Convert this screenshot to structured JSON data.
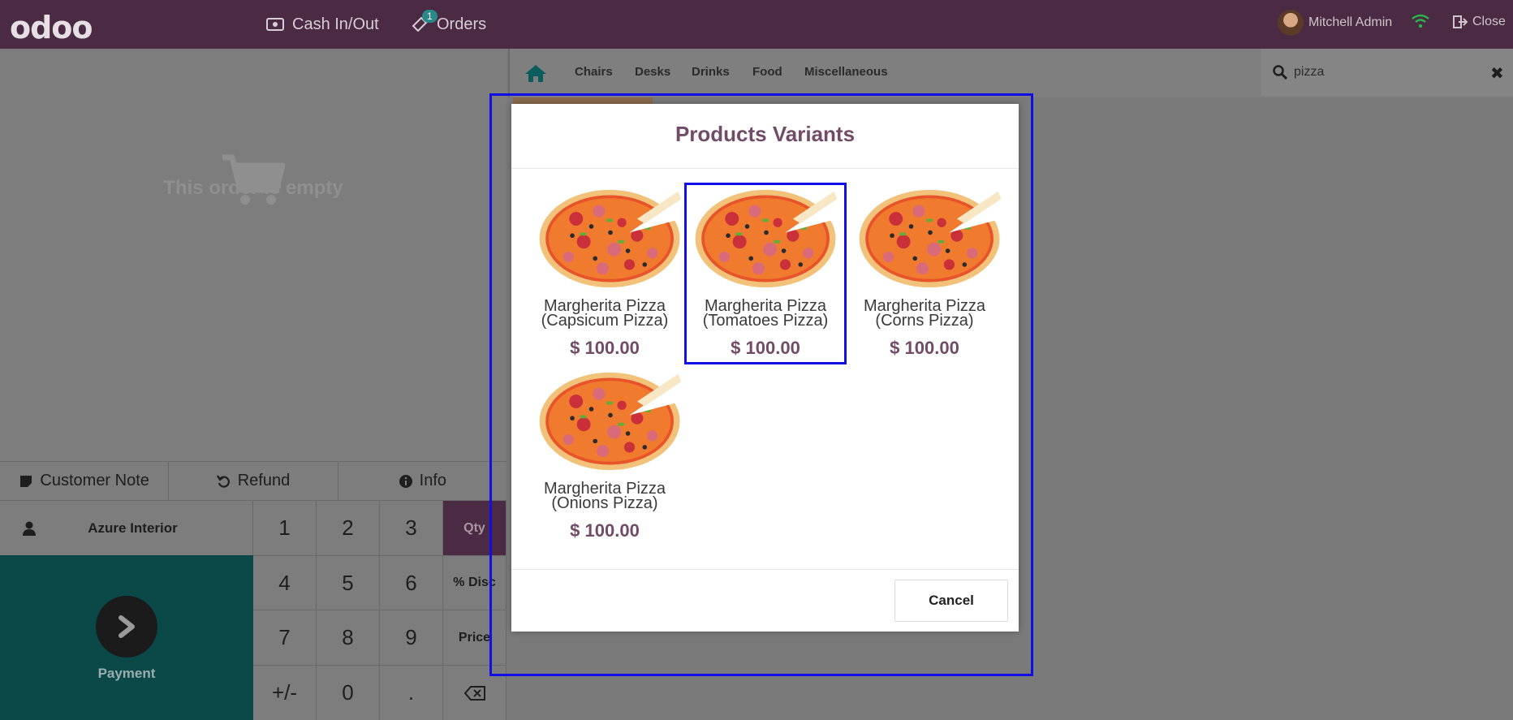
{
  "topbar": {
    "logo": "odoo",
    "cash_label": "Cash In/Out",
    "orders_label": "Orders",
    "orders_badge": "1",
    "user_name": "Mitchell Admin",
    "close_label": "Close"
  },
  "order": {
    "empty_text": "This order is empty"
  },
  "actions": {
    "customer_note": "Customer Note",
    "refund": "Refund",
    "info": "Info"
  },
  "customer": {
    "name": "Azure Interior"
  },
  "payment": {
    "label": "Payment"
  },
  "numpad": {
    "k1": "1",
    "k2": "2",
    "k3": "3",
    "qty": "Qty",
    "k4": "4",
    "k5": "5",
    "k6": "6",
    "disc": "% Disc",
    "k7": "7",
    "k8": "8",
    "k9": "9",
    "price": "Price",
    "sign": "+/-",
    "k0": "0",
    "dot": "."
  },
  "categories": [
    "Chairs",
    "Desks",
    "Drinks",
    "Food",
    "Miscellaneous"
  ],
  "search": {
    "value": "pizza"
  },
  "modal": {
    "title": "Products Variants",
    "cancel": "Cancel",
    "variants": [
      {
        "line1": "Margherita Pizza",
        "line2": "(Capsicum Pizza)",
        "price": "$ 100.00"
      },
      {
        "line1": "Margherita Pizza",
        "line2": "(Tomatoes Pizza)",
        "price": "$ 100.00"
      },
      {
        "line1": "Margherita Pizza",
        "line2": "(Corns Pizza)",
        "price": "$ 100.00"
      },
      {
        "line1": "Margherita Pizza",
        "line2": "(Onions Pizza)",
        "price": "$ 100.00"
      }
    ]
  },
  "colors": {
    "brand": "#714b67",
    "topbar": "#4b2a43",
    "payment": "#0b4848",
    "highlight": "#1010e6"
  }
}
